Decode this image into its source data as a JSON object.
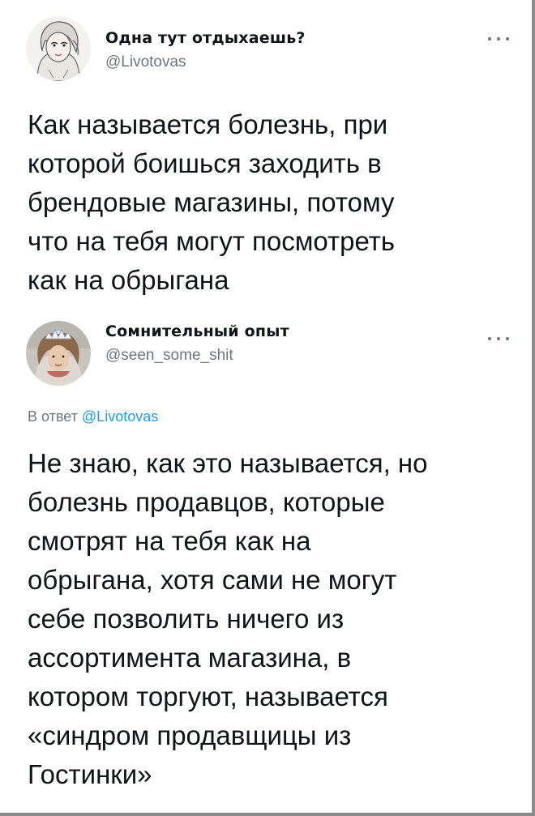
{
  "tweets": [
    {
      "author_name": "Одна тут отдыхаешь?",
      "handle": "@Livotovas",
      "avatar_icon": "illustrated-girl-avatar",
      "text": "Как называется болезнь, при\nкоторой боишься заходить в\nбрендовые магазины, потому\nчто на тебя могут посмотреть\nкак на обрыгана"
    },
    {
      "author_name": "Сомнительный опыт",
      "handle": "@seen_some_shit",
      "avatar_icon": "woman-with-tiara-avatar",
      "reply_prefix": "В ответ",
      "reply_mention": "@Livotovas",
      "text": "Не знаю, как это называется, но\nболезнь продавцов, которые\nсмотрят на тебя как на\nобрыгана, хотя сами не могут\nсебе позволить ничего из\nассортимента магазина, в\nкотором торгуют, называется\n«синдром продавщицы из\nГостинки»"
    }
  ],
  "colors": {
    "text": "#0f1419",
    "secondary": "#6b7680",
    "link": "#1d9bf0",
    "border": "#8a8a8a"
  }
}
